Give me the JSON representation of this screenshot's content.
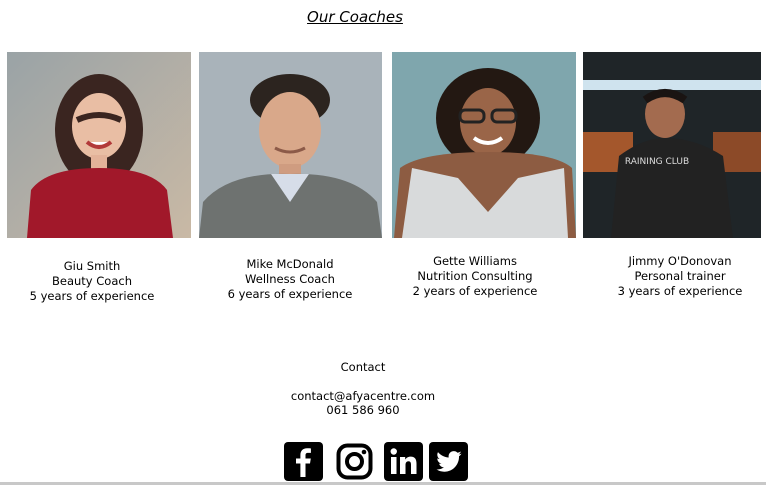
{
  "page": {
    "title": "Our Coaches"
  },
  "coaches": [
    {
      "name": "Giu Smith",
      "role": "Beauty Coach",
      "experience": "5 years of experience"
    },
    {
      "name": "Mike McDonald",
      "role": "Wellness Coach",
      "experience": "6 years of experience"
    },
    {
      "name": "Gette Williams",
      "role": "Nutrition Consulting",
      "experience": "2 years of experience"
    },
    {
      "name": "Jimmy O'Donovan",
      "role": "Personal trainer",
      "experience": "3 years of experience"
    }
  ],
  "contact": {
    "heading": "Contact",
    "email": "contact@afyacentre.com",
    "phone": "061 586 960"
  },
  "social_icons": [
    "facebook-icon",
    "instagram-icon",
    "linkedin-icon",
    "twitter-icon"
  ],
  "colors": {
    "text": "#000000",
    "background": "#ffffff",
    "icon_tile": "#000000"
  }
}
